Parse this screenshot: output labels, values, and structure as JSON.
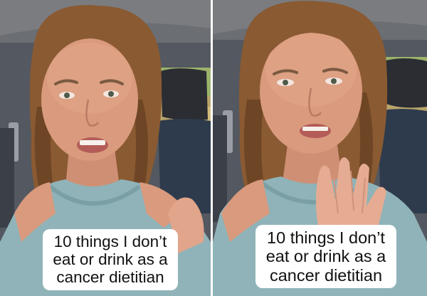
{
  "frames": [
    {
      "caption_lines": [
        "10 things I don’t",
        "eat or drink as a",
        "cancer dietitian"
      ]
    },
    {
      "caption_lines": [
        "10 things I don’t",
        "eat or drink as a",
        "cancer dietitian"
      ]
    }
  ],
  "colors": {
    "car_interior": "#4a4e55",
    "seat": "#2f3a4a",
    "skin": "#d99a7e",
    "hair": "#8a5a32",
    "tank_top": "#8fb3b8",
    "caption_bg": "#ffffff",
    "caption_text": "#111111"
  }
}
